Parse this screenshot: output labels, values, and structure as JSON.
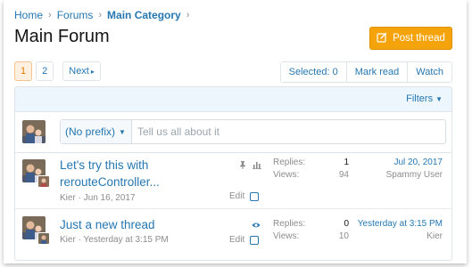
{
  "breadcrumb": [
    {
      "label": "Home"
    },
    {
      "label": "Forums"
    },
    {
      "label": "Main Category"
    }
  ],
  "page_title": "Main Forum",
  "post_thread_label": "Post thread",
  "pagination": {
    "pages": [
      "1",
      "2"
    ],
    "current": "1",
    "next_label": "Next"
  },
  "toolbar": {
    "selected_label": "Selected: 0",
    "mark_read_label": "Mark read",
    "watch_label": "Watch"
  },
  "filters_label": "Filters",
  "quick_thread": {
    "prefix_label": "(No prefix)",
    "placeholder": "Tell us all about it"
  },
  "threads": [
    {
      "title_line1": "Let's try this with",
      "title_line2": "rerouteController...",
      "author": "Kier",
      "date": "Jun 16, 2017",
      "icons": [
        "pin-icon",
        "poll-icon"
      ],
      "edit_label": "Edit",
      "replies_label": "Replies:",
      "replies": "1",
      "views_label": "Views:",
      "views": "94",
      "last_date": "Jul 20, 2017",
      "last_user": "Spammy User"
    },
    {
      "title_line1": "Just a new thread",
      "author": "Kier",
      "date": "Yesterday at 3:15 PM",
      "icons": [
        "watched-eye-icon"
      ],
      "edit_label": "Edit",
      "replies_label": "Replies:",
      "replies": "0",
      "views_label": "Views:",
      "views": "10",
      "last_date": "Yesterday at 3:15 PM",
      "last_user": "Kier"
    }
  ],
  "colors": {
    "link": "#2577b1",
    "accent": "#f5a30a",
    "filter_bar": "#edf6fd",
    "muted": "#8c8c8c"
  }
}
